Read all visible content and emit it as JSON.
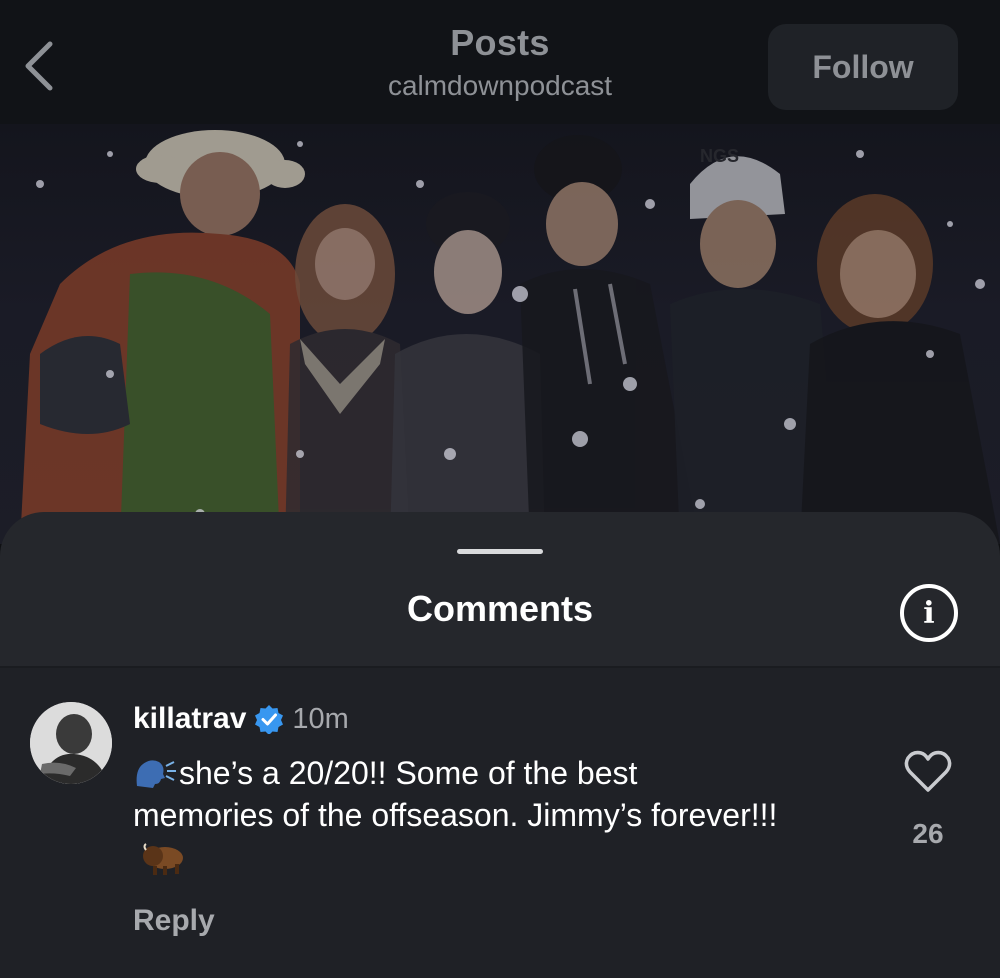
{
  "header": {
    "title": "Posts",
    "subtitle": "calmdownpodcast",
    "follow_label": "Follow"
  },
  "photo": {
    "hat_text": "NGS",
    "background_color": "#1a1b26"
  },
  "comments": {
    "title": "Comments",
    "info_label": "i",
    "items": [
      {
        "username": "killatrav",
        "verified": true,
        "time": "10m",
        "text": "she’s a 20/20!! Some of the best memories of the offseason. Jimmy’s forever!!!",
        "likes": "26",
        "reply_label": "Reply",
        "emojis": [
          "speaking-head-icon",
          "bison-icon"
        ]
      }
    ]
  },
  "colors": {
    "accent_verified": "#3897f0",
    "sheet_bg": "#25272c",
    "muted_text": "#a7a9ad"
  }
}
